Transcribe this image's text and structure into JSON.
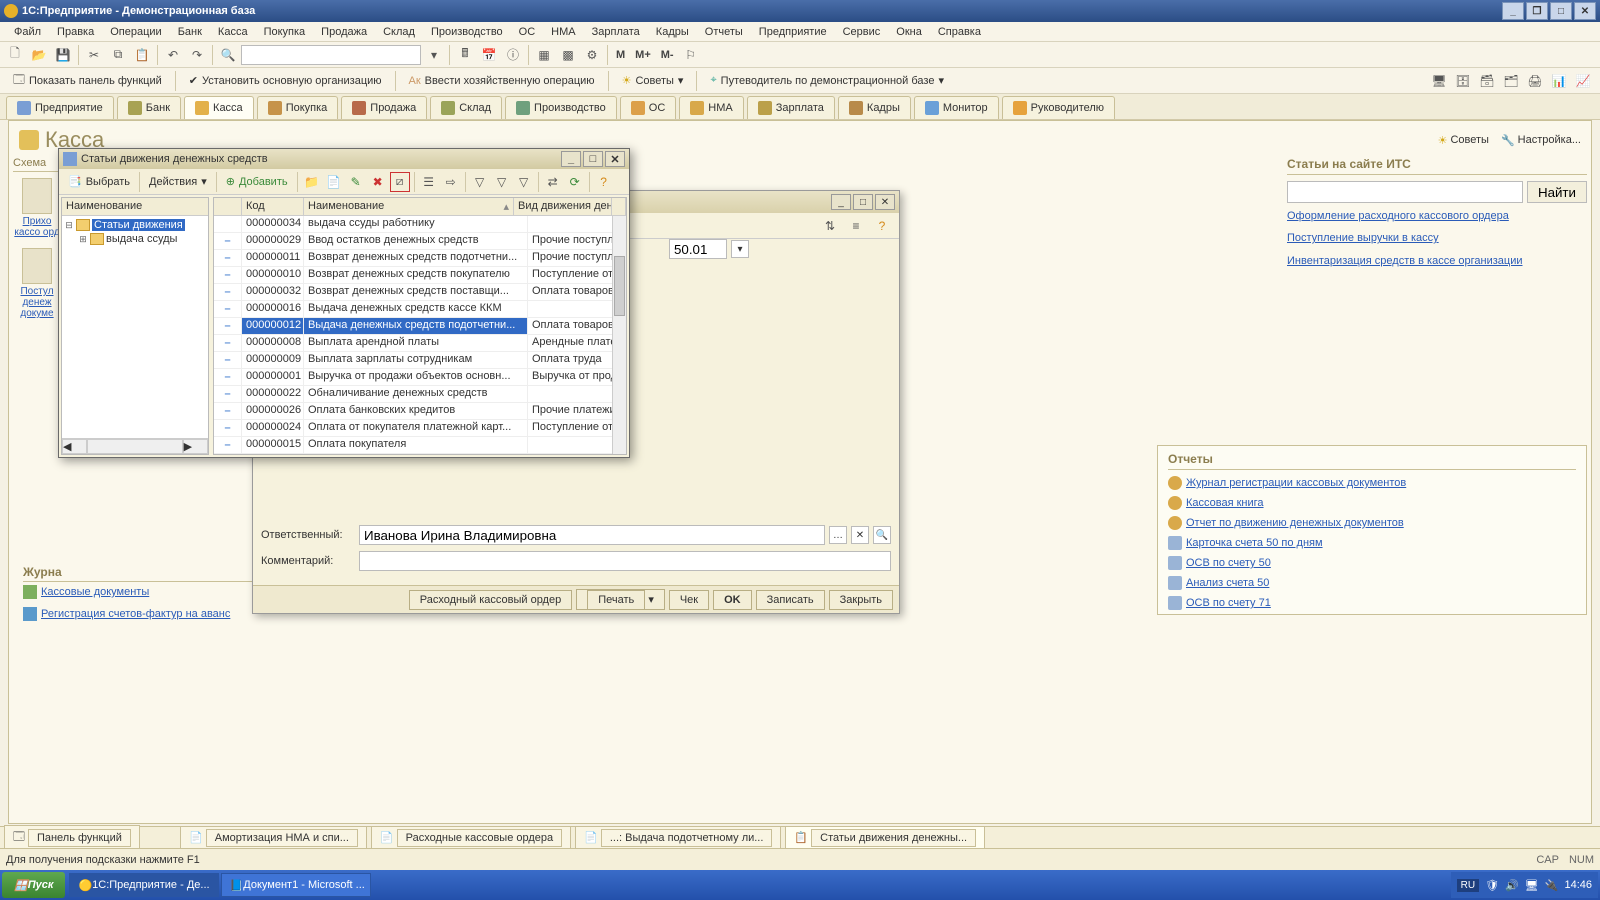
{
  "window": {
    "title": "1С:Предприятие - Демонстрационная база"
  },
  "menu": [
    "Файл",
    "Правка",
    "Операции",
    "Банк",
    "Касса",
    "Покупка",
    "Продажа",
    "Склад",
    "Производство",
    "ОС",
    "НМА",
    "Зарплата",
    "Кадры",
    "Отчеты",
    "Предприятие",
    "Сервис",
    "Окна",
    "Справка"
  ],
  "topcmds": {
    "panel": "Показать панель функций",
    "setorg": "Установить основную организацию",
    "oper": "Ввести хозяйственную операцию",
    "tips": "Советы",
    "guide": "Путеводитель по демонстрационной базе"
  },
  "marks": {
    "m": "M",
    "mplus": "M+",
    "mminus": "M-"
  },
  "tabs": [
    "Предприятие",
    "Банк",
    "Касса",
    "Покупка",
    "Продажа",
    "Склад",
    "Производство",
    "ОС",
    "НМА",
    "Зарплата",
    "Кадры",
    "Монитор",
    "Руководителю"
  ],
  "page": {
    "title": "Касса",
    "tips": "Советы",
    "settings": "Настройка..."
  },
  "scheme": {
    "label": "Схема",
    "c1": "Прихо\nкассо\nорд",
    "c2": "Постул\nденеж\nдокуме"
  },
  "its": {
    "title": "Статьи на сайте ИТС",
    "find": "Найти",
    "links": [
      "Оформление расходного кассового ордера",
      "Поступление выручки в кассу",
      "Инвентаризация средств в кассе организации"
    ]
  },
  "journals": {
    "title": "Журна",
    "l1": "Кассовые документы",
    "l2": "Регистрация счетов-фактур на аванс"
  },
  "reports": {
    "title": "Отчеты",
    "items": [
      "Журнал регистрации кассовых документов",
      "Кассовая книга",
      "Отчет по движению денежных документов",
      "Карточка счета 50 по дням",
      "ОСВ по счету 50",
      "Анализ счета 50",
      "ОСВ по счету 71"
    ]
  },
  "under": {
    "account": "50.01",
    "resp_label": "Ответственный:",
    "resp_value": "Иванова Ирина Владимировна",
    "comment_label": "Комментарий:",
    "buttons": [
      "Расходный кассовый ордер",
      "Печать",
      "Чек",
      "OK",
      "Записать",
      "Закрыть"
    ]
  },
  "modal": {
    "title": "Статьи движения денежных средств",
    "tool": {
      "select": "Выбрать",
      "actions": "Действия",
      "add": "Добавить"
    },
    "tree": {
      "header": "Наименование",
      "root": "Статьи движения",
      "child": "выдача ссуды"
    },
    "headers": {
      "code": "Код",
      "name": "Наименование",
      "kind": "Вид движения дене..."
    },
    "rows": [
      {
        "code": "000000034",
        "name": "выдача ссуды работнику",
        "kind": ""
      },
      {
        "code": "000000029",
        "name": "Ввод остатков денежных средств",
        "kind": "Прочие поступлени..."
      },
      {
        "code": "000000011",
        "name": "Возврат денежных средств подотчетни...",
        "kind": "Прочие поступлени..."
      },
      {
        "code": "000000010",
        "name": "Возврат денежных средств покупателю",
        "kind": "Поступление от пр..."
      },
      {
        "code": "000000032",
        "name": "Возврат денежных средств поставщи...",
        "kind": "Оплата товаров, ра..."
      },
      {
        "code": "000000016",
        "name": "Выдача денежных средств кассе ККМ",
        "kind": ""
      },
      {
        "code": "000000012",
        "name": "Выдача денежных средств подотчетни...",
        "kind": "Оплата товаров, ра..."
      },
      {
        "code": "000000008",
        "name": "Выплата арендной платы",
        "kind": "Арендные платежи,..."
      },
      {
        "code": "000000009",
        "name": "Выплата зарплаты сотрудникам",
        "kind": "Оплата труда"
      },
      {
        "code": "000000001",
        "name": "Выручка от продажи объектов основн...",
        "kind": "Выручка от продаж..."
      },
      {
        "code": "000000022",
        "name": "Обналичивание денежных средств",
        "kind": ""
      },
      {
        "code": "000000026",
        "name": "Оплата банковских кредитов",
        "kind": "Прочие платежи по..."
      },
      {
        "code": "000000024",
        "name": "Оплата от покупателя платежной карт...",
        "kind": "Поступление от пр..."
      },
      {
        "code": "000000015",
        "name": "Оплата покупателя",
        "kind": ""
      }
    ],
    "selected": 6
  },
  "wndbar": {
    "panel": "Панель функций",
    "w1": "Амортизация НМА и спи...",
    "w2": "Расходные кассовые ордера",
    "w3": "...: Выдача подотчетному ли...",
    "w4": "Статьи движения денежны..."
  },
  "status": {
    "hint": "Для получения подсказки нажмите F1",
    "cap": "CAP",
    "num": "NUM"
  },
  "taskbar": {
    "start": "Пуск",
    "t1": "1С:Предприятие - Де...",
    "t2": "Документ1 - Microsoft ...",
    "lang": "RU",
    "time": "14:46"
  }
}
